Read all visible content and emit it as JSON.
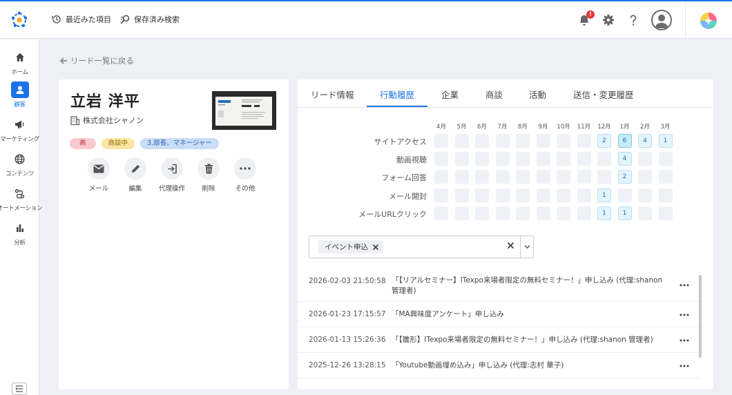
{
  "header": {
    "recent_label": "最近みた項目",
    "saved_search_label": "保存済み検索",
    "notification_count": "!"
  },
  "sidebar": {
    "items": [
      {
        "label": "ホーム",
        "icon": "home-icon"
      },
      {
        "label": "顧客",
        "icon": "person-icon",
        "active": true
      },
      {
        "label": "マーケティング",
        "icon": "megaphone-icon"
      },
      {
        "label": "コンテンツ",
        "icon": "globe-icon"
      },
      {
        "label": "オートメーション",
        "icon": "automation-icon"
      },
      {
        "label": "分析",
        "icon": "bar-chart-icon"
      }
    ]
  },
  "back_link": "リード一覧に戻る",
  "lead": {
    "name": "立岩 洋平",
    "company": "株式会社シャノン",
    "badges": [
      "高",
      "商談中",
      "3.部長、マネージャー"
    ],
    "actions": [
      "メール",
      "編集",
      "代理操作",
      "削除",
      "その他"
    ]
  },
  "tabs": [
    "リード情報",
    "行動履歴",
    "企業",
    "商談",
    "活動",
    "送信・変更履歴"
  ],
  "active_tab": "行動履歴",
  "heatmap": {
    "months": [
      "4月",
      "5月",
      "6月",
      "7月",
      "8月",
      "9月",
      "10月",
      "11月",
      "12月",
      "1月",
      "2月",
      "3月"
    ],
    "rows": [
      {
        "label": "サイトアクセス",
        "values": [
          null,
          null,
          null,
          null,
          null,
          null,
          null,
          null,
          2,
          6,
          4,
          1
        ]
      },
      {
        "label": "動画視聴",
        "values": [
          null,
          null,
          null,
          null,
          null,
          null,
          null,
          null,
          null,
          4,
          null,
          null
        ]
      },
      {
        "label": "フォーム回答",
        "values": [
          null,
          null,
          null,
          null,
          null,
          null,
          null,
          null,
          null,
          2,
          null,
          null
        ]
      },
      {
        "label": "メール開封",
        "values": [
          null,
          null,
          null,
          null,
          null,
          null,
          null,
          null,
          1,
          null,
          null,
          null
        ]
      },
      {
        "label": "メールURLクリック",
        "values": [
          null,
          null,
          null,
          null,
          null,
          null,
          null,
          null,
          1,
          1,
          null,
          null
        ]
      }
    ]
  },
  "filter": {
    "chip": "イベント申込"
  },
  "activities": [
    {
      "date": "2026-02-03 21:50:58",
      "text": "「【リアルセミナー】ITexpo来場者限定の無料セミナー！」申し込み (代理:shanon 管理者)"
    },
    {
      "date": "2026-01-23 17:15:57",
      "text": "「MA興味度アンケート」申し込み"
    },
    {
      "date": "2026-01-13 15:26:36",
      "text": "「【雛形】ITexpo来場者限定の無料セミナー！」申し込み (代理:shanon 管理者)"
    },
    {
      "date": "2025-12-26 13:28:15",
      "text": "「Youtube動画埋め込み」申し込み (代理:志村 華子)"
    }
  ],
  "colors": {
    "accent": "#1a73e8",
    "badge_high": "#f7c9cc",
    "badge_deal": "#fbe6a6",
    "badge_role": "#c9ddf7"
  }
}
